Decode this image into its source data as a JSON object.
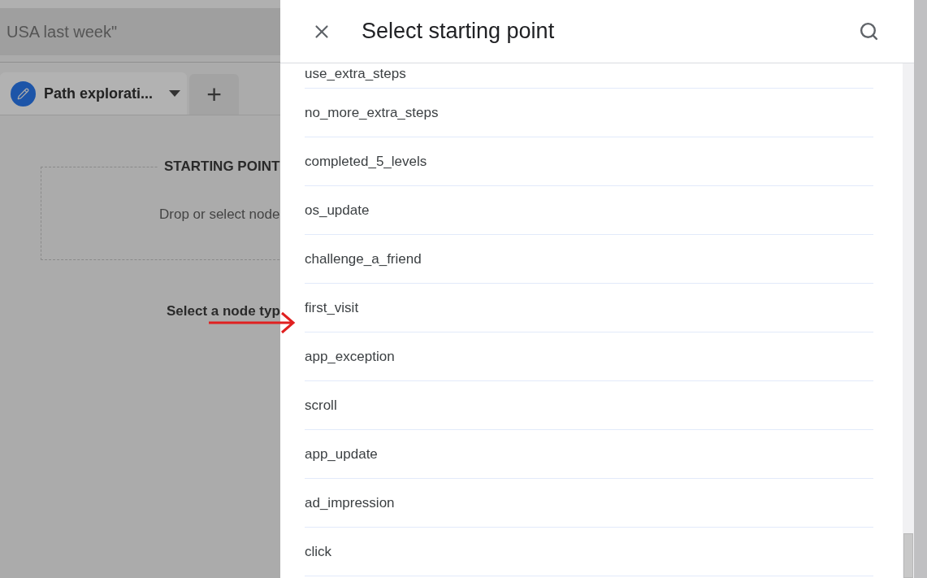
{
  "search_bar": {
    "text": "USA last week\""
  },
  "tabs": [
    {
      "label": "Path explorati...",
      "selected": true
    }
  ],
  "add_tab": {
    "label": "+"
  },
  "starting_point": {
    "title": "STARTING POINT",
    "hint": "Drop or select node"
  },
  "node_type_label": "Select a node typ",
  "panel": {
    "title": "Select starting point",
    "items": [
      {
        "label": "use_extra_steps"
      },
      {
        "label": "no_more_extra_steps"
      },
      {
        "label": "completed_5_levels"
      },
      {
        "label": "os_update"
      },
      {
        "label": "challenge_a_friend"
      },
      {
        "label": "first_visit"
      },
      {
        "label": "app_exception"
      },
      {
        "label": "scroll"
      },
      {
        "label": "app_update"
      },
      {
        "label": "ad_impression"
      },
      {
        "label": "click"
      }
    ]
  }
}
